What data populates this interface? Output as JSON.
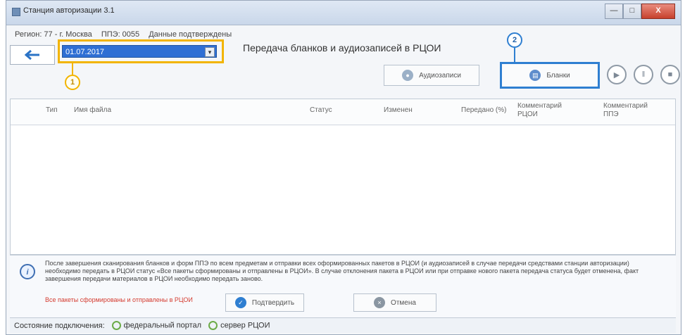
{
  "window": {
    "title": "Станция авторизации 3.1",
    "controls": {
      "minimize": "—",
      "maximize": "□",
      "close": "X"
    }
  },
  "status_line": {
    "region": "Регион: 77 - г. Москва",
    "ppe": "ППЭ: 0055",
    "state": "Данные подтверждены"
  },
  "header": {
    "date": "01.07.2017",
    "title": "Передача бланков и аудиозаписей в РЦОИ",
    "callout_1": "1",
    "callout_2": "2"
  },
  "buttons": {
    "audio": "Аудиозаписи",
    "blanks": "Бланки",
    "confirm": "Подтвердить",
    "cancel": "Отмена"
  },
  "table": {
    "columns": [
      "Тип",
      "Имя файла",
      "Статус",
      "Изменен",
      "Передано (%)",
      "Комментарий РЦОИ",
      "Комментарий ППЭ"
    ]
  },
  "info": {
    "text": "После завершения сканирования бланков и форм ППЭ по всем предметам и отправки всех оформированных пакетов в РЦОИ (и аудиозаписей в случае передачи средствами станции авторизации) необходимо передать в РЦОИ статус «Все пакеты сформированы и отправлены в РЦОИ». В случае отклонения пакета в РЦОИ или при отправке нового пакета передача статуса будет отменена, факт завершения передачи материалов в РЦОИ необходимо передать заново.",
    "red": "Все пакеты сформированы и отправлены в РЦОИ"
  },
  "footer": {
    "label": "Состояние подключения:",
    "federal": "федеральный портал",
    "server": "сервер РЦОИ"
  }
}
